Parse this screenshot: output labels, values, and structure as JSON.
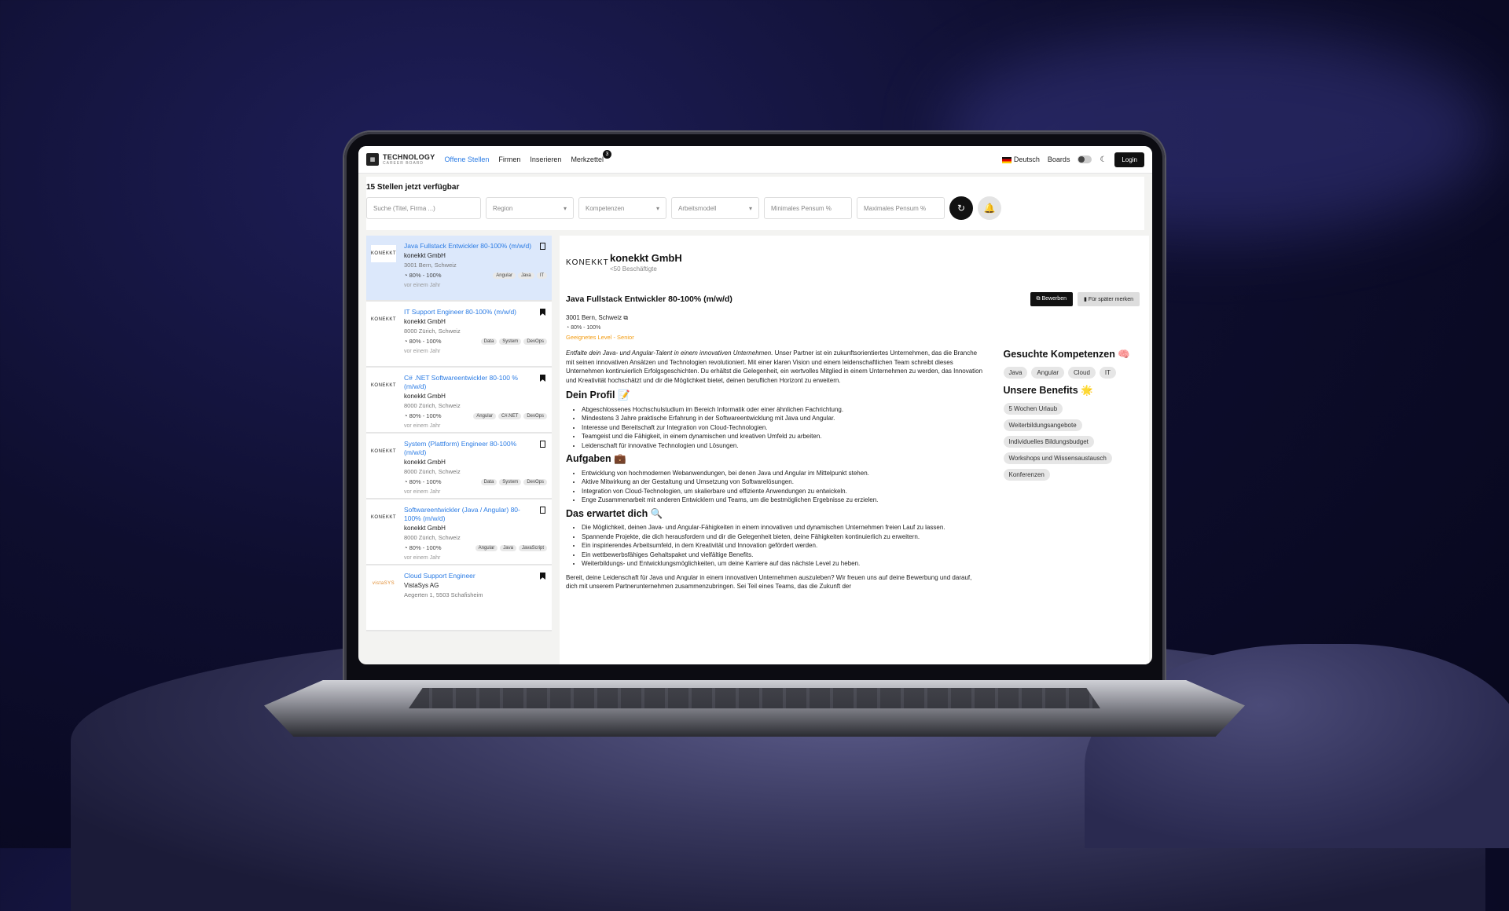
{
  "nav": {
    "logo_title": "TECHNOLOGY",
    "logo_sub": "CAREER BOARD",
    "links": [
      {
        "label": "Offene Stellen"
      },
      {
        "label": "Firmen"
      },
      {
        "label": "Inserieren"
      },
      {
        "label": "Merkzettel"
      }
    ],
    "badge_count": "3",
    "language": "Deutsch",
    "boards": "Boards",
    "login": "Login"
  },
  "filters": {
    "count_text": "15 Stellen jetzt verfügbar",
    "search_placeholder": "Suche (Titel, Firma ...)",
    "region": "Region",
    "kompetenzen": "Kompetenzen",
    "arbeitsmodell": "Arbeitsmodell",
    "min_pensum": "Minimales Pensum %",
    "max_pensum": "Maximales Pensum %"
  },
  "jobs": [
    {
      "title": "Java Fullstack Entwickler 80-100% (m/w/d)",
      "company": "konekkt GmbH",
      "location": "3001 Bern, Schweiz",
      "pensum": "80% - 100%",
      "tags": [
        "Angular",
        "Java",
        "IT"
      ],
      "time": "vor einem Jahr",
      "logo": "KONEKKT"
    },
    {
      "title": "IT Support Engineer 80-100% (m/w/d)",
      "company": "konekkt GmbH",
      "location": "8000 Zürich, Schweiz",
      "pensum": "80% - 100%",
      "tags": [
        "Data",
        "System",
        "DevOps"
      ],
      "time": "vor einem Jahr",
      "logo": "KONEKKT"
    },
    {
      "title": "C# .NET Softwareentwickler 80-100 % (m/w/d)",
      "company": "konekkt GmbH",
      "location": "8000 Zürich, Schweiz",
      "pensum": "80% - 100%",
      "tags": [
        "Angular",
        "C#.NET",
        "DevOps"
      ],
      "time": "vor einem Jahr",
      "logo": "KONEKKT"
    },
    {
      "title": "System (Plattform) Engineer 80-100% (m/w/d)",
      "company": "konekkt GmbH",
      "location": "8000 Zürich, Schweiz",
      "pensum": "80% - 100%",
      "tags": [
        "Data",
        "System",
        "DevOps"
      ],
      "time": "vor einem Jahr",
      "logo": "KONEKKT"
    },
    {
      "title": "Softwareentwickler (Java / Angular) 80-100% (m/w/d)",
      "company": "konekkt GmbH",
      "location": "8000 Zürich, Schweiz",
      "pensum": "80% - 100%",
      "tags": [
        "Angular",
        "Java",
        "JavaScript"
      ],
      "time": "vor einem Jahr",
      "logo": "KONEKKT"
    },
    {
      "title": "Cloud Support Engineer",
      "company": "VistaSys AG",
      "location": "Aegerten 1, 5503 Schafisheim",
      "pensum": "",
      "tags": [],
      "time": "",
      "logo": "vistaSYS"
    }
  ],
  "detail": {
    "logo": "KONEKKT",
    "company": "konekkt GmbH",
    "employees": "<50 Beschäftigte",
    "job_title": "Java Fullstack Entwickler 80-100% (m/w/d)",
    "apply": "Bewerben",
    "save": "Für später merken",
    "location": "3001 Bern, Schweiz",
    "pensum": "80% - 100%",
    "level": "Geeignetes Level - Senior",
    "intro_italic": "Entfalte dein Java- und Angular-Talent in einem innovativen Unternehmen.",
    "intro_rest": " Unser Partner ist ein zukunftsorientiertes Unternehmen, das die Branche mit seinen innovativen Ansätzen und Technologien revolutioniert. Mit einer klaren Vision und einem leidenschaftlichen Team schreibt dieses Unternehmen kontinuierlich Erfolgsgeschichten. Du erhältst die Gelegenheit, ein wertvolles Mitglied in einem Unternehmen zu werden, das Innovation und Kreativität hochschätzt und dir die Möglichkeit bietet, deinen beruflichen Horizont zu erweitern.",
    "profil_heading": "Dein Profil 📝",
    "profil": [
      "Abgeschlossenes Hochschulstudium im Bereich Informatik oder einer ähnlichen Fachrichtung.",
      "Mindestens 3 Jahre praktische Erfahrung in der Softwareentwicklung mit Java und Angular.",
      "Interesse und Bereitschaft zur Integration von Cloud-Technologien.",
      "Teamgeist und die Fähigkeit, in einem dynamischen und kreativen Umfeld zu arbeiten.",
      "Leidenschaft für innovative Technologien und Lösungen."
    ],
    "aufgaben_heading": "Aufgaben 💼",
    "aufgaben": [
      "Entwicklung von hochmodernen Webanwendungen, bei denen Java und Angular im Mittelpunkt stehen.",
      "Aktive Mitwirkung an der Gestaltung und Umsetzung von Softwarelösungen.",
      "Integration von Cloud-Technologien, um skalierbare und effiziente Anwendungen zu entwickeln.",
      "Enge Zusammenarbeit mit anderen Entwicklern und Teams, um die bestmöglichen Ergebnisse zu erzielen."
    ],
    "erwartet_heading": "Das erwartet dich 🔍",
    "erwartet": [
      "Die Möglichkeit, deinen Java- und Angular-Fähigkeiten in einem innovativen und dynamischen Unternehmen freien Lauf zu lassen.",
      "Spannende Projekte, die dich herausfordern und dir die Gelegenheit bieten, deine Fähigkeiten kontinuierlich zu erweitern.",
      "Ein inspirierendes Arbeitsumfeld, in dem Kreativität und Innovation gefördert werden.",
      "Ein wettbewerbsfähiges Gehaltspaket und vielfältige Benefits.",
      "Weiterbildungs- und Entwicklungsmöglichkeiten, um deine Karriere auf das nächste Level zu heben."
    ],
    "outro": "Bereit, deine Leidenschaft für Java und Angular in einem innovativen Unternehmen auszuleben? Wir freuen uns auf deine Bewerbung und darauf, dich mit unserem Partnerunternehmen zusammenzubringen. Sei Teil eines Teams, das die Zukunft der",
    "kompetenzen_heading": "Gesuchte Kompetenzen 🧠",
    "kompetenzen": [
      "Java",
      "Angular",
      "Cloud",
      "IT"
    ],
    "benefits_heading": "Unsere Benefits 🌟",
    "benefits": [
      "5 Wochen Urlaub",
      "Weiterbildungsangebote",
      "Individuelles Bildungsbudget",
      "Workshops und Wissensaustausch",
      "Konferenzen"
    ]
  }
}
